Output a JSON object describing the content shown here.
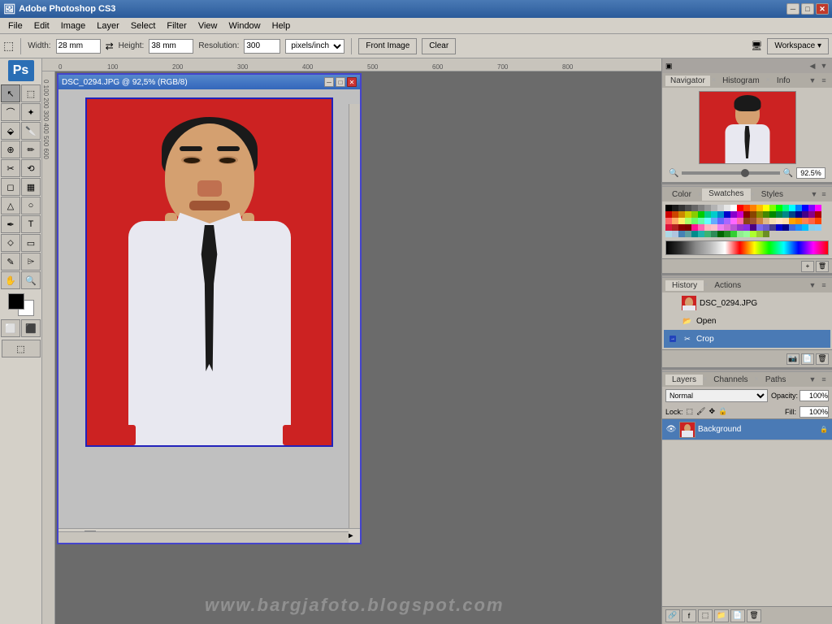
{
  "app": {
    "title": "Adobe Photoshop CS3",
    "ps_logo": "Ps"
  },
  "titlebar": {
    "title": "Adobe Photoshop CS3",
    "minimize": "─",
    "maximize": "□",
    "close": "✕"
  },
  "menubar": {
    "items": [
      "File",
      "Edit",
      "Image",
      "Layer",
      "Select",
      "Filter",
      "View",
      "Window",
      "Help"
    ]
  },
  "toolbar": {
    "width_label": "Width:",
    "width_value": "28 mm",
    "height_label": "Height:",
    "height_value": "38 mm",
    "resolution_label": "Resolution:",
    "resolution_value": "300",
    "resolution_unit": "pixels/inch",
    "front_image_btn": "Front Image",
    "clear_btn": "Clear",
    "workspace_btn": "Workspace ▾"
  },
  "document": {
    "title": "DSC_0294.JPG @ 92,5% (RGB/8)",
    "zoom": "92,5%"
  },
  "navigator": {
    "tabs": [
      "Navigator",
      "Histogram",
      "Info"
    ],
    "active_tab": "Navigator",
    "zoom_value": "92.5%"
  },
  "color_panel": {
    "tabs": [
      "Color",
      "Swatches",
      "Styles"
    ],
    "active_tab": "Swatches"
  },
  "swatches": {
    "colors": [
      "#000000",
      "#1a1a1a",
      "#333333",
      "#4d4d4d",
      "#666666",
      "#808080",
      "#999999",
      "#b3b3b3",
      "#cccccc",
      "#e6e6e6",
      "#ffffff",
      "#ff0000",
      "#ff4000",
      "#ff8000",
      "#ffbf00",
      "#ffff00",
      "#80ff00",
      "#00ff00",
      "#00ff80",
      "#00ffff",
      "#0080ff",
      "#0000ff",
      "#8000ff",
      "#ff00ff",
      "#cc0000",
      "#cc4400",
      "#cc8800",
      "#cccc00",
      "#88cc00",
      "#00cc00",
      "#00cc88",
      "#00cccc",
      "#0088cc",
      "#0000cc",
      "#8800cc",
      "#cc00cc",
      "#880000",
      "#884400",
      "#888800",
      "#448800",
      "#008800",
      "#008844",
      "#008888",
      "#004488",
      "#000088",
      "#440088",
      "#880088",
      "#aa0000",
      "#ff6666",
      "#ffaa66",
      "#ffee66",
      "#aaff66",
      "#66ff66",
      "#66ffaa",
      "#66ffff",
      "#66aaff",
      "#6666ff",
      "#aa66ff",
      "#ff66ff",
      "#ff66aa",
      "#8b4513",
      "#a0522d",
      "#cd853f",
      "#deb887",
      "#f5deb3",
      "#ffe4c4",
      "#ffdead",
      "#ffa500",
      "#ff8c00",
      "#ff7f50",
      "#ff6347",
      "#ff4500",
      "#dc143c",
      "#b22222",
      "#8b0000",
      "#800000",
      "#ff1493",
      "#ff69b4",
      "#ffb6c1",
      "#ffc0cb",
      "#ee82ee",
      "#da70d6",
      "#ba55d3",
      "#9932cc",
      "#8a2be2",
      "#4b0082",
      "#7b68ee",
      "#6a5acd",
      "#483d8b",
      "#0000cd",
      "#00008b",
      "#4169e1",
      "#1e90ff",
      "#00bfff",
      "#87ceeb",
      "#87cefa",
      "#add8e6",
      "#b0c4de",
      "#4682b4",
      "#5f9ea0",
      "#008b8b",
      "#20b2aa",
      "#3cb371",
      "#2e8b57",
      "#006400",
      "#228b22",
      "#32cd32",
      "#90ee90",
      "#98fb98",
      "#adff2f",
      "#9acd32",
      "#6b8e23"
    ]
  },
  "history": {
    "tabs": [
      "History",
      "Actions"
    ],
    "active_tab": "History",
    "items": [
      {
        "name": "DSC_0294.JPG",
        "has_thumb": true,
        "icon": "📷"
      },
      {
        "name": "Open",
        "has_thumb": false,
        "icon": "📂"
      },
      {
        "name": "Crop",
        "has_thumb": false,
        "icon": "✂",
        "active": true
      }
    ]
  },
  "layers": {
    "tabs": [
      "Layers",
      "Channels",
      "Paths"
    ],
    "active_tab": "Layers",
    "mode": "Normal",
    "opacity": "100%",
    "fill": "100%",
    "items": [
      {
        "name": "Background",
        "visible": true,
        "locked": true,
        "active": true
      }
    ],
    "lock_label": "Lock:"
  },
  "tools": {
    "items": [
      "↖",
      "✂",
      "⊹",
      "⌖",
      "✏",
      "✒",
      "🖌",
      "⟨",
      "△",
      "✎",
      "⬚",
      "⊘",
      "✥",
      "⊙",
      "⊡",
      "☌",
      "◯",
      "⊞",
      "✆",
      "◉",
      "✞",
      "⊿",
      "⊻",
      "⊹",
      "⌃",
      "✁",
      "★",
      "⊛",
      "✓",
      "⊟"
    ]
  },
  "colors": {
    "foreground": "#000000",
    "background": "#ffffff"
  },
  "watermark": "www.bargjafoto.blogspot.com"
}
